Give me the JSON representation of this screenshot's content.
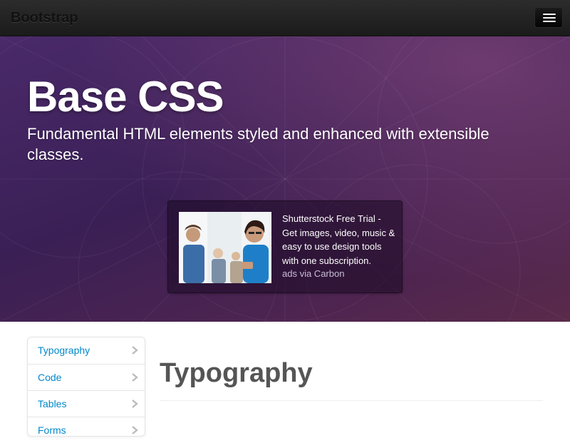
{
  "navbar": {
    "brand": "Bootstrap",
    "toggle_icon": "hamburger-menu-icon"
  },
  "hero": {
    "title": "Base CSS",
    "subtitle": "Fundamental HTML elements styled and enhanced with extensible classes."
  },
  "ad": {
    "text": "Shutterstock Free Trial - Get images, video, music & easy to use design tools with one subscription.",
    "via": "ads via Carbon"
  },
  "sidebar": {
    "items": [
      {
        "label": "Typography",
        "icon": "chevron-right-icon"
      },
      {
        "label": "Code",
        "icon": "chevron-right-icon"
      },
      {
        "label": "Tables",
        "icon": "chevron-right-icon"
      },
      {
        "label": "Forms",
        "icon": "chevron-right-icon"
      }
    ]
  },
  "main": {
    "section_title": "Typography"
  },
  "colors": {
    "link": "#0088cc",
    "navbar": "#1b1b1b",
    "hero": "#3a1f55",
    "heading": "#555555"
  }
}
